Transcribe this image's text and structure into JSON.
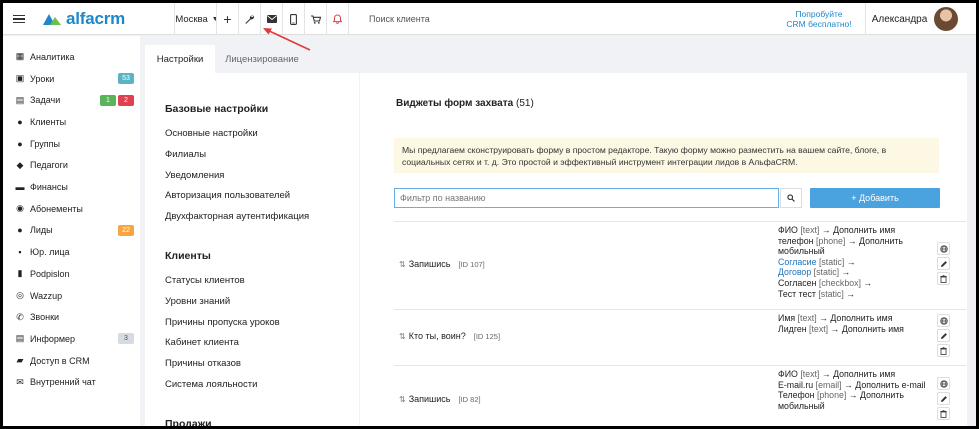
{
  "header": {
    "logo_text": "alfacrm",
    "branch": "Москва",
    "search_placeholder": "Поиск клиента",
    "trial_line1": "Попробуйте",
    "trial_line2": "CRM бесплатно!",
    "user_name": "Александра"
  },
  "sidebar": {
    "items": [
      {
        "label": "Аналитика",
        "icon": "book-icon"
      },
      {
        "label": "Уроки",
        "icon": "calendar-icon",
        "badges": [
          "53"
        ]
      },
      {
        "label": "Задачи",
        "icon": "clipboard-icon",
        "badges": [
          "1",
          "2"
        ]
      },
      {
        "label": "Клиенты",
        "icon": "user-icon"
      },
      {
        "label": "Группы",
        "icon": "users-icon"
      },
      {
        "label": "Педагоги",
        "icon": "graduation-cap-icon"
      },
      {
        "label": "Финансы",
        "icon": "money-icon"
      },
      {
        "label": "Абонементы",
        "icon": "compass-icon"
      },
      {
        "label": "Лиды",
        "icon": "user-plus-icon",
        "badges": [
          "22"
        ]
      },
      {
        "label": "Юр. лица",
        "icon": "briefcase-icon"
      },
      {
        "label": "Podpislon",
        "icon": "file-icon"
      },
      {
        "label": "Wazzup",
        "icon": "whatsapp-icon"
      },
      {
        "label": "Звонки",
        "icon": "phone-icon"
      },
      {
        "label": "Информер",
        "icon": "notebook-icon",
        "badges": [
          "3"
        ]
      },
      {
        "label": "Доступ в CRM",
        "icon": "lock-icon"
      },
      {
        "label": "Внутренний чат",
        "icon": "envelope-icon"
      }
    ]
  },
  "tabs": {
    "settings": "Настройки",
    "licensing": "Лицензирование"
  },
  "settings_menu": {
    "basic_title": "Базовые настройки",
    "basic_items": [
      "Основные настройки",
      "Филиалы",
      "Уведомления",
      "Авторизация пользователей",
      "Двухфакторная аутентификация"
    ],
    "clients_title": "Клиенты",
    "clients_items": [
      "Статусы клиентов",
      "Уровни знаний",
      "Причины пропуска уроков",
      "Кабинет клиента",
      "Причины отказов",
      "Система лояльности"
    ],
    "sales_title": "Продажи"
  },
  "main": {
    "title": "Виджеты форм захвата",
    "count": "(51)",
    "info_text": "Мы предлагаем сконструировать форму в простом редакторе. Такую форму можно разместить на вашем сайте, блоге, в социальных сетях и т. д. Это простой и эффективный инструмент интеграции лидов в АльфаCRM.",
    "filter_placeholder": "Фильтр по названию",
    "add_button": "+ Добавить",
    "forms": [
      {
        "name": "Запишись",
        "id": "[ID 107]",
        "fields": [
          {
            "label": "ФИО",
            "type": "[text]",
            "target": "→ Дополнить имя"
          },
          {
            "label": "телефон",
            "type": "[phone]",
            "target": "→ Дополнить мобильный"
          },
          {
            "label": "Согласие",
            "type": "[static]",
            "target": "→",
            "link": true
          },
          {
            "label": "Договор",
            "type": "[static]",
            "target": "→",
            "link": true
          },
          {
            "label": "Согласен",
            "type": "[checkbox]",
            "target": "→"
          },
          {
            "label": "Тест тест",
            "type": "[static]",
            "target": "→"
          }
        ]
      },
      {
        "name": "Кто ты, воин?",
        "id": "[ID 125]",
        "fields": [
          {
            "label": "Имя",
            "type": "[text]",
            "target": "→ Дополнить имя"
          },
          {
            "label": "Лидген",
            "type": "[text]",
            "target": "→ Дополнить имя"
          }
        ]
      },
      {
        "name": "Запишись",
        "id": "[ID 82]",
        "fields": [
          {
            "label": "ФИО",
            "type": "[text]",
            "target": "→ Дополнить имя"
          },
          {
            "label": "E-mail.ru",
            "type": "[email]",
            "target": "→ Дополнить e-mail"
          },
          {
            "label": "Телефон",
            "type": "[phone]",
            "target": "→ Дополнить мобильный"
          }
        ]
      }
    ]
  },
  "colors": {
    "brand": "#1e88c8",
    "add_button": "#4aa3df",
    "arrow": "#e03a3a",
    "info_bg": "#fcf8e3"
  }
}
